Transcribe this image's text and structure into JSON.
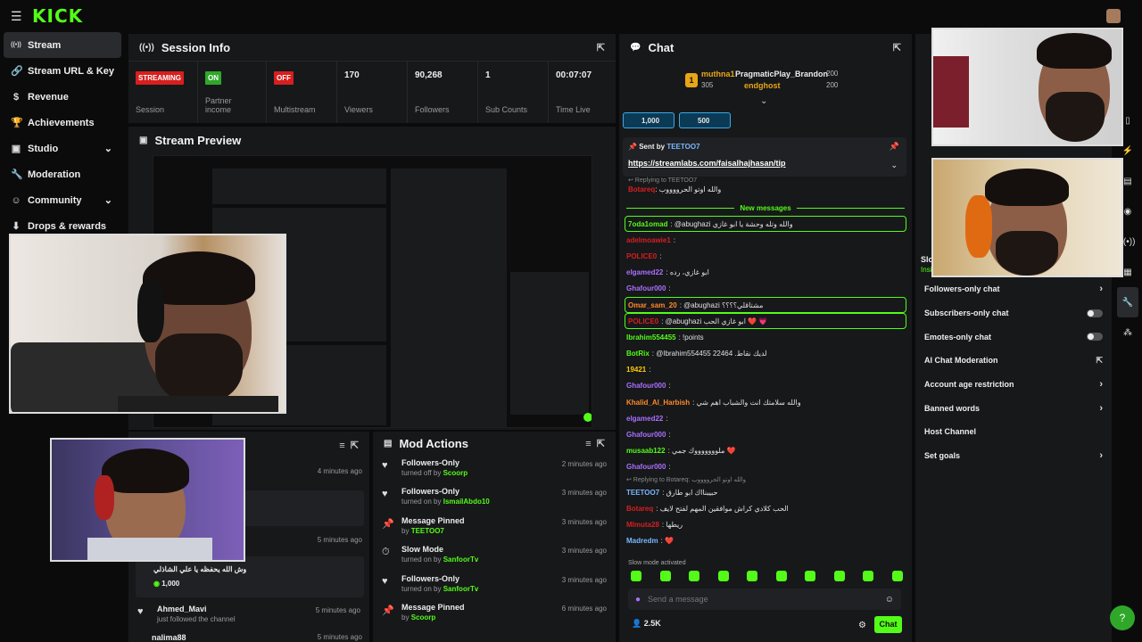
{
  "app": {
    "logo": "KICK"
  },
  "sidebar": {
    "items": [
      {
        "icon": "((•))",
        "label": "Stream"
      },
      {
        "icon": "🔗",
        "label": "Stream URL & Key"
      },
      {
        "icon": "$",
        "label": "Revenue"
      },
      {
        "icon": "🏆",
        "label": "Achievements"
      },
      {
        "icon": "▣",
        "label": "Studio"
      },
      {
        "icon": "🔧",
        "label": "Moderation"
      },
      {
        "icon": "☺",
        "label": "Community"
      },
      {
        "icon": "⬇",
        "label": "Drops & rewards"
      }
    ]
  },
  "session": {
    "title": "Session Info",
    "badges": [
      {
        "badge": "STREAMING",
        "label": "Session",
        "color": "#d61f1f"
      },
      {
        "badge": "ON",
        "label": "Partner income",
        "color": "#2fa82a"
      },
      {
        "badge": "OFF",
        "label": "Multistream",
        "color": "#d61f1f"
      }
    ],
    "stats": [
      {
        "value": "170",
        "label": "Viewers"
      },
      {
        "value": "90,268",
        "label": "Followers"
      },
      {
        "value": "1",
        "label": "Sub Counts"
      },
      {
        "value": "00:07:07",
        "label": "Time Live"
      }
    ]
  },
  "preview": {
    "title": "Stream Preview"
  },
  "activity": {
    "times": [
      "4 minutes ago",
      "5 minutes ago",
      "5 minutes ago",
      "5 minutes ago"
    ],
    "message": "وش الله يحفظه يا علي الشاذلي",
    "kicks": "1,000",
    "follow_user": "Ahmed_Mavi",
    "follow_sub": "just followed the channel",
    "last_user": "nalima88"
  },
  "mod_actions": {
    "title": "Mod Actions",
    "items": [
      {
        "icon": "♥",
        "title": "Followers-Only",
        "sub": "turned off by",
        "user": "Scoorp",
        "time": "2 minutes ago"
      },
      {
        "icon": "♥",
        "title": "Followers-Only",
        "sub": "turned on by",
        "user": "IsmailAbdo10",
        "time": "3 minutes ago"
      },
      {
        "icon": "📌",
        "title": "Message Pinned",
        "sub": "by",
        "user": "TEETOO7",
        "time": "3 minutes ago"
      },
      {
        "icon": "⏱",
        "title": "Slow Mode",
        "sub": "turned on by",
        "user": "SanfoorTv",
        "time": "3 minutes ago"
      },
      {
        "icon": "♥",
        "title": "Followers-Only",
        "sub": "turned on by",
        "user": "SanfoorTv",
        "time": "3 minutes ago"
      },
      {
        "icon": "📌",
        "title": "Message Pinned",
        "sub": "by",
        "user": "Scoorp",
        "time": "6 minutes ago"
      }
    ]
  },
  "chat": {
    "title": "Chat",
    "leaders": [
      {
        "name": "muthna1",
        "score": "305"
      },
      {
        "name": "PragmaticPlay_Brandon",
        "score": "200"
      },
      {
        "name": "endghost",
        "score": "200"
      }
    ],
    "rank_badge": "1",
    "kicks_pills": [
      "1,000",
      "500"
    ],
    "pinned": {
      "sent_by": "Sent by",
      "user": "TEETOO7",
      "link": "https://streamlabs.com/faisalhajhasan/tip"
    },
    "reply_line": "↩ Replying to TEETOO7",
    "top_msg_user": "Botareq",
    "top_msg_text": ": والله اوتو الحرووووب",
    "new_messages": "New messages",
    "messages": [
      {
        "user": "7oda1omad",
        "color": "#53fc18",
        "text": ": @abughazi والله وتله وحشة يا ابو غازي",
        "hl": true
      },
      {
        "user": "adelmoawie1",
        "color": "#d61f1f",
        "text": ":",
        "hl": false
      },
      {
        "user": "POLICE0",
        "color": "#d61f1f",
        "text": ":",
        "hl": false
      },
      {
        "user": "elgamed22",
        "color": "#a970ff",
        "text": ": ابو غازي، رده",
        "hl": false
      },
      {
        "user": "Ghafour000",
        "color": "#a970ff",
        "text": ":",
        "hl": false
      },
      {
        "user": "Omar_sam_20",
        "color": "#ff8a2a",
        "text": ": @abughazi مشتاقلي؟؟؟؟",
        "hl": true
      },
      {
        "user": "POLICE0",
        "color": "#d61f1f",
        "text": ": @abughazi ابو غازي الحب ❤️ 💗",
        "hl": true
      },
      {
        "user": "Ibrahim554455",
        "color": "#53fc18",
        "text": ": !points",
        "hl": false
      },
      {
        "user": "BotRix",
        "color": "#53fc18",
        "text": ": @Ibrahim554455 22464 .لديك نقاط",
        "hl": false
      },
      {
        "user": "19421",
        "color": "#ffcc00",
        "text": ":",
        "hl": false
      },
      {
        "user": "Ghafour000",
        "color": "#a970ff",
        "text": ":",
        "hl": false
      },
      {
        "user": "Khalid_Al_Harbish",
        "color": "#ff8a2a",
        "text": ": والله سلامتك انت والشباب اهم شي",
        "hl": false
      },
      {
        "user": "elgamed22",
        "color": "#a970ff",
        "text": ":",
        "hl": false
      },
      {
        "user": "Ghafour000",
        "color": "#a970ff",
        "text": ":",
        "hl": false
      },
      {
        "user": "musaab122",
        "color": "#53fc18",
        "text": ": ملوووووووك جمي ❤️",
        "hl": false
      },
      {
        "user": "Ghafour000",
        "color": "#a970ff",
        "text": ":",
        "hl": false
      },
      {
        "user": "TEETOO7",
        "color": "#7ab8ff",
        "text": ": حبيبنااك ابو طارق",
        "hl": false
      },
      {
        "user": "Botareq",
        "color": "#d61f1f",
        "text": ": الحب كلادي كراش موافقين المهم لفتح لايف",
        "hl": false
      },
      {
        "user": "Mlmuta28",
        "color": "#d61f1f",
        "text": ": ريطها",
        "hl": false
      },
      {
        "user": "Madredm",
        "color": "#7ab8ff",
        "text": ": ❤️",
        "hl": false
      }
    ],
    "reply_line2": "↩ Replying to Botareq: والله اوتو الحرووووب",
    "slow_mode": "Slow mode activated",
    "input_placeholder": "Send a message",
    "viewers": "2.5K",
    "send_label": "Chat"
  },
  "settings": {
    "slow_label": "Slo",
    "slow_sub": "Insi",
    "items": [
      {
        "label": "Followers-only chat",
        "kind": "chevron"
      },
      {
        "label": "Subscribers-only chat",
        "kind": "toggle"
      },
      {
        "label": "Emotes-only chat",
        "kind": "toggle"
      },
      {
        "label": "AI Chat Moderation",
        "kind": "external"
      },
      {
        "label": "Account age restriction",
        "kind": "chevron"
      },
      {
        "label": "Banned words",
        "kind": "chevron"
      },
      {
        "label": "Host Channel",
        "kind": "none"
      },
      {
        "label": "Set goals",
        "kind": "chevron"
      }
    ]
  },
  "colors": {
    "accent": "#53fc18",
    "panel": "#17181a",
    "bg": "#0b0b0c"
  }
}
